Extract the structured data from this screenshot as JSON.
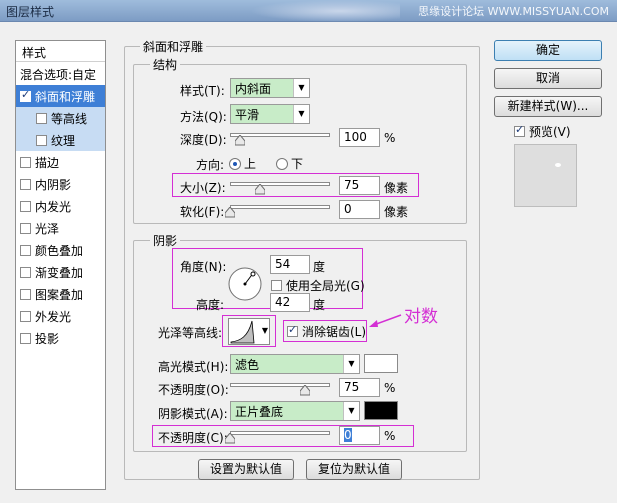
{
  "window": {
    "title": "图层样式",
    "brand": "思缘设计论坛 WWW.MISSYUAN.COM"
  },
  "style_list": {
    "header": "样式",
    "items": [
      {
        "label": "混合选项:自定",
        "checkbox": false,
        "checked": false,
        "state": "normal"
      },
      {
        "label": "斜面和浮雕",
        "checkbox": true,
        "checked": true,
        "state": "selected"
      },
      {
        "label": "等高线",
        "checkbox": true,
        "checked": false,
        "state": "sub"
      },
      {
        "label": "纹理",
        "checkbox": true,
        "checked": false,
        "state": "sub"
      },
      {
        "label": "描边",
        "checkbox": true,
        "checked": false,
        "state": "normal"
      },
      {
        "label": "内阴影",
        "checkbox": true,
        "checked": false,
        "state": "normal"
      },
      {
        "label": "内发光",
        "checkbox": true,
        "checked": false,
        "state": "normal"
      },
      {
        "label": "光泽",
        "checkbox": true,
        "checked": false,
        "state": "normal"
      },
      {
        "label": "颜色叠加",
        "checkbox": true,
        "checked": false,
        "state": "normal"
      },
      {
        "label": "渐变叠加",
        "checkbox": true,
        "checked": false,
        "state": "normal"
      },
      {
        "label": "图案叠加",
        "checkbox": true,
        "checked": false,
        "state": "normal"
      },
      {
        "label": "外发光",
        "checkbox": true,
        "checked": false,
        "state": "normal"
      },
      {
        "label": "投影",
        "checkbox": true,
        "checked": false,
        "state": "normal"
      }
    ]
  },
  "bevel": {
    "group_title": "斜面和浮雕",
    "structure": {
      "title": "结构",
      "style_label": "样式(T):",
      "style_value": "内斜面",
      "technique_label": "方法(Q):",
      "technique_value": "平滑",
      "depth_label": "深度(D):",
      "depth_value": "100",
      "depth_unit": "%",
      "depth_level": 0.1,
      "direction_label": "方向:",
      "direction_up": "上",
      "direction_down": "下",
      "size_label": "大小(Z):",
      "size_value": "75",
      "size_unit": "像素",
      "size_level": 0.3,
      "soften_label": "软化(F):",
      "soften_value": "0",
      "soften_unit": "像素",
      "soften_level": 0.0
    },
    "shading": {
      "title": "阴影",
      "angle_label": "角度(N):",
      "angle_value": "54",
      "angle_unit": "度",
      "global_light_label": "使用全局光(G)",
      "altitude_label": "高度:",
      "altitude_value": "42",
      "altitude_unit": "度",
      "gloss_contour_label": "光泽等高线:",
      "anti_alias_label": "消除锯齿(L)",
      "annotation": "对数",
      "highlight_mode_label": "高光模式(H):",
      "highlight_mode_value": "滤色",
      "highlight_color": "#ffffff",
      "highlight_opacity_label": "不透明度(O):",
      "highlight_opacity_value": "75",
      "highlight_opacity_unit": "%",
      "highlight_opacity_level": 0.75,
      "shadow_mode_label": "阴影模式(A):",
      "shadow_mode_value": "正片叠底",
      "shadow_color": "#000000",
      "shadow_opacity_label": "不透明度(C):",
      "shadow_opacity_value": "0",
      "shadow_opacity_unit": "%",
      "shadow_opacity_level": 0.0
    },
    "set_default": "设置为默认值",
    "reset_default": "复位为默认值"
  },
  "buttons": {
    "ok": "确定",
    "cancel": "取消",
    "new_style": "新建样式(W)...",
    "preview": "预览(V)"
  },
  "colors": {
    "accent": "#3e7fd6",
    "highlight": "#d42fd4",
    "combo_bg": "#c8ecc8"
  }
}
